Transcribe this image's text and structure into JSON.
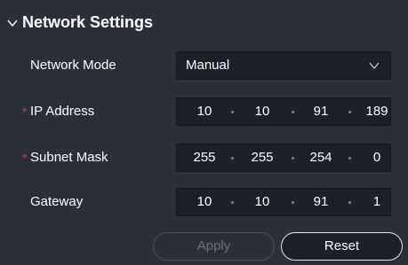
{
  "section": {
    "title": "Network Settings"
  },
  "network_mode": {
    "label": "Network Mode",
    "value": "Manual"
  },
  "ip_address": {
    "label": "IP Address",
    "required": "*",
    "octets": [
      "10",
      "10",
      "91",
      "189"
    ]
  },
  "subnet_mask": {
    "label": "Subnet Mask",
    "required": "*",
    "octets": [
      "255",
      "255",
      "254",
      "0"
    ]
  },
  "gateway": {
    "label": "Gateway",
    "octets": [
      "10",
      "10",
      "91",
      "1"
    ]
  },
  "buttons": {
    "apply": "Apply",
    "reset": "Reset"
  },
  "colors": {
    "background": "#2a2f38",
    "field_background": "#1c2027",
    "required_star": "#e0303c",
    "disabled_text": "#6a6f77"
  },
  "icons": {
    "section_toggle": "chevron-down-icon",
    "select_toggle": "chevron-down-icon"
  }
}
